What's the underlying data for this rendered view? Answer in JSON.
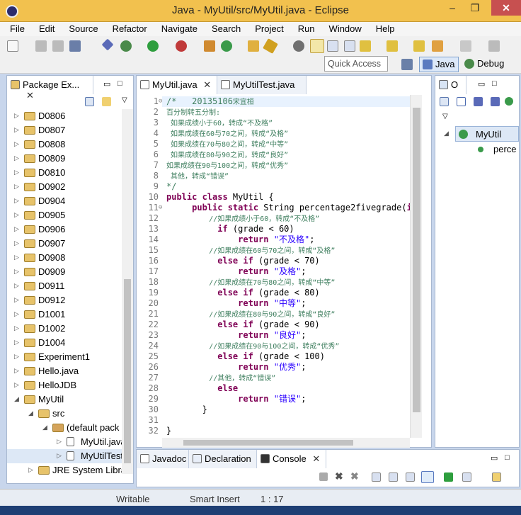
{
  "window": {
    "title": "Java - MyUtil/src/MyUtil.java - Eclipse",
    "minimize": "–",
    "maximize": "❐",
    "close": "✕"
  },
  "menu": [
    "File",
    "Edit",
    "Source",
    "Refactor",
    "Navigate",
    "Search",
    "Project",
    "Run",
    "Window",
    "Help"
  ],
  "toolbar": {
    "quick_access_placeholder": "Quick Access"
  },
  "perspectives": {
    "java": "Java",
    "debug": "Debug"
  },
  "package_explorer": {
    "tab": "Package Ex...",
    "items": [
      {
        "label": "D0806",
        "level": 0,
        "expanded": false
      },
      {
        "label": "D0807",
        "level": 0,
        "expanded": false
      },
      {
        "label": "D0808",
        "level": 0,
        "expanded": false
      },
      {
        "label": "D0809",
        "level": 0,
        "expanded": false
      },
      {
        "label": "D0810",
        "level": 0,
        "expanded": false
      },
      {
        "label": "D0902",
        "level": 0,
        "expanded": false
      },
      {
        "label": "D0904",
        "level": 0,
        "expanded": false
      },
      {
        "label": "D0905",
        "level": 0,
        "expanded": false
      },
      {
        "label": "D0906",
        "level": 0,
        "expanded": false
      },
      {
        "label": "D0907",
        "level": 0,
        "expanded": false
      },
      {
        "label": "D0908",
        "level": 0,
        "expanded": false
      },
      {
        "label": "D0909",
        "level": 0,
        "expanded": false
      },
      {
        "label": "D0911",
        "level": 0,
        "expanded": false
      },
      {
        "label": "D0912",
        "level": 0,
        "expanded": false
      },
      {
        "label": "D1001",
        "level": 0,
        "expanded": false
      },
      {
        "label": "D1002",
        "level": 0,
        "expanded": false
      },
      {
        "label": "D1004",
        "level": 0,
        "expanded": false
      },
      {
        "label": "Experiment1",
        "level": 0,
        "expanded": false
      },
      {
        "label": "Hello.java",
        "level": 0,
        "expanded": false
      },
      {
        "label": "HelloJDB",
        "level": 0,
        "expanded": false
      },
      {
        "label": "MyUtil",
        "level": 0,
        "expanded": true
      },
      {
        "label": "src",
        "level": 1,
        "expanded": true
      },
      {
        "label": "(default pack",
        "level": 2,
        "expanded": true
      },
      {
        "label": "MyUtil.java",
        "level": 3,
        "expanded": false
      },
      {
        "label": "MyUtilTest",
        "level": 3,
        "expanded": false
      },
      {
        "label": "JRE System Libra",
        "level": 1,
        "expanded": false
      }
    ]
  },
  "editor": {
    "tabs": [
      "MyUtil.java",
      "MyUtilTest.java"
    ],
    "lines": [
      {
        "n": "1",
        "tokens": [
          {
            "t": "/*   20135106",
            "c": "cm"
          },
          {
            "t": "宋宜桓",
            "c": "cm small"
          }
        ]
      },
      {
        "n": "2",
        "tokens": [
          {
            "t": "百分制转五分制:",
            "c": "cm small"
          }
        ]
      },
      {
        "n": "3",
        "tokens": [
          {
            "t": " 如果成绩小于60，转成“不及格”",
            "c": "cm small"
          }
        ]
      },
      {
        "n": "4",
        "tokens": [
          {
            "t": " 如果成绩在60与70之间，转成“及格”",
            "c": "cm small"
          }
        ]
      },
      {
        "n": "5",
        "tokens": [
          {
            "t": " 如果成绩在70与80之间，转成“中等”",
            "c": "cm small"
          }
        ]
      },
      {
        "n": "6",
        "tokens": [
          {
            "t": " 如果成绩在80与90之间，转成“良好”",
            "c": "cm small"
          }
        ]
      },
      {
        "n": "7",
        "tokens": [
          {
            "t": "如果成绩在90与100之间，转成“优秀”",
            "c": "cm small"
          }
        ]
      },
      {
        "n": "8",
        "tokens": [
          {
            "t": " 其他，转成“错误”",
            "c": "cm small"
          }
        ]
      },
      {
        "n": "9",
        "tokens": [
          {
            "t": "*/",
            "c": "cm"
          }
        ]
      },
      {
        "n": "10",
        "tokens": [
          {
            "t": "public class",
            "c": "kw"
          },
          {
            "t": " MyUtil {",
            "c": ""
          }
        ]
      },
      {
        "n": "11",
        "tokens": [
          {
            "t": "     public static",
            "c": "kw"
          },
          {
            "t": " String percentage2fivegrade(",
            "c": ""
          },
          {
            "t": "in",
            "c": "kw"
          }
        ]
      },
      {
        "n": "12",
        "tokens": [
          {
            "t": "          //如果成绩小于60，转成“不及格”",
            "c": "cm small"
          }
        ]
      },
      {
        "n": "13",
        "tokens": [
          {
            "t": "          if",
            "c": "kw"
          },
          {
            "t": " (grade < 60)",
            "c": ""
          }
        ]
      },
      {
        "n": "14",
        "tokens": [
          {
            "t": "              return",
            "c": "kw"
          },
          {
            "t": " ",
            "c": ""
          },
          {
            "t": "\"不及格\"",
            "c": "str"
          },
          {
            "t": ";",
            "c": ""
          }
        ]
      },
      {
        "n": "15",
        "tokens": [
          {
            "t": "          //如果成绩在60与70之间，转成“及格”",
            "c": "cm small"
          }
        ]
      },
      {
        "n": "16",
        "tokens": [
          {
            "t": "          else if",
            "c": "kw"
          },
          {
            "t": " (grade < 70)",
            "c": ""
          }
        ]
      },
      {
        "n": "17",
        "tokens": [
          {
            "t": "              return",
            "c": "kw"
          },
          {
            "t": " ",
            "c": ""
          },
          {
            "t": "\"及格\"",
            "c": "str"
          },
          {
            "t": ";",
            "c": ""
          }
        ]
      },
      {
        "n": "18",
        "tokens": [
          {
            "t": "          //如果成绩在70与80之间，转成“中等”",
            "c": "cm small"
          }
        ]
      },
      {
        "n": "19",
        "tokens": [
          {
            "t": "          else if",
            "c": "kw"
          },
          {
            "t": " (grade < 80)",
            "c": ""
          }
        ]
      },
      {
        "n": "20",
        "tokens": [
          {
            "t": "              return",
            "c": "kw"
          },
          {
            "t": " ",
            "c": ""
          },
          {
            "t": "\"中等\"",
            "c": "str"
          },
          {
            "t": ";",
            "c": ""
          }
        ]
      },
      {
        "n": "21",
        "tokens": [
          {
            "t": "          //如果成绩在80与90之间，转成“良好”",
            "c": "cm small"
          }
        ]
      },
      {
        "n": "22",
        "tokens": [
          {
            "t": "          else if",
            "c": "kw"
          },
          {
            "t": " (grade < 90)",
            "c": ""
          }
        ]
      },
      {
        "n": "23",
        "tokens": [
          {
            "t": "              return",
            "c": "kw"
          },
          {
            "t": " ",
            "c": ""
          },
          {
            "t": "\"良好\"",
            "c": "str"
          },
          {
            "t": ";",
            "c": ""
          }
        ]
      },
      {
        "n": "24",
        "tokens": [
          {
            "t": "          //如果成绩在90与100之间，转成“优秀”",
            "c": "cm small"
          }
        ]
      },
      {
        "n": "25",
        "tokens": [
          {
            "t": "          else if",
            "c": "kw"
          },
          {
            "t": " (grade < 100)",
            "c": ""
          }
        ]
      },
      {
        "n": "26",
        "tokens": [
          {
            "t": "              return",
            "c": "kw"
          },
          {
            "t": " ",
            "c": ""
          },
          {
            "t": "\"优秀\"",
            "c": "str"
          },
          {
            "t": ";",
            "c": ""
          }
        ]
      },
      {
        "n": "27",
        "tokens": [
          {
            "t": "          //其他，转成“错误”",
            "c": "cm small"
          }
        ]
      },
      {
        "n": "28",
        "tokens": [
          {
            "t": "          else",
            "c": "kw"
          }
        ]
      },
      {
        "n": "29",
        "tokens": [
          {
            "t": "              return",
            "c": "kw"
          },
          {
            "t": " ",
            "c": ""
          },
          {
            "t": "\"错误\"",
            "c": "str"
          },
          {
            "t": ";",
            "c": ""
          }
        ]
      },
      {
        "n": "30",
        "tokens": [
          {
            "t": "       }",
            "c": ""
          }
        ]
      },
      {
        "n": "31",
        "tokens": []
      },
      {
        "n": "32",
        "tokens": [
          {
            "t": "}",
            "c": ""
          }
        ]
      }
    ]
  },
  "outline": {
    "tab": "O",
    "items": [
      {
        "label": "MyUtil"
      },
      {
        "label": "perce"
      }
    ]
  },
  "bottom_tabs": [
    "Javadoc",
    "Declaration",
    "Console"
  ],
  "status": {
    "writable": "Writable",
    "insert_mode": "Smart Insert",
    "position": "1 : 17"
  },
  "colors": {
    "titlebar": "#f2c14e",
    "keyword": "#7f0055",
    "comment": "#3f7f5f",
    "string": "#2a00ff"
  }
}
